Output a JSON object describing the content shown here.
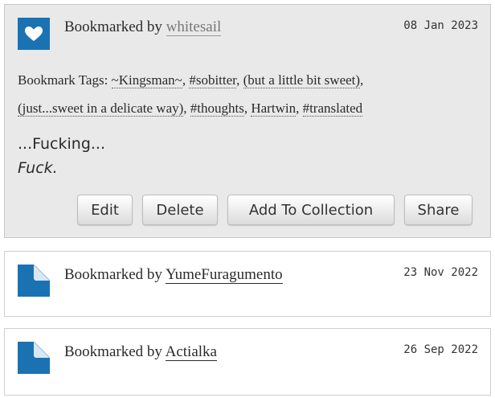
{
  "bookmarks": [
    {
      "by_label": "Bookmarked by",
      "user": "whitesail",
      "date": "08 Jan 2023",
      "tags_label": "Bookmark Tags:",
      "tags": [
        "~Kingsman~",
        "#sobitter",
        "(but a little bit sweet)",
        "(just...sweet in a delicate way)",
        "#thoughts",
        "Hartwin",
        "#translated"
      ],
      "note_lines": [
        "...Fucking...",
        "Fuck."
      ],
      "actions": {
        "edit": "Edit",
        "delete": "Delete",
        "add_to_collection": "Add To Collection",
        "share": "Share"
      },
      "icon": "heart-icon"
    },
    {
      "by_label": "Bookmarked by",
      "user": "YumeFuragumento",
      "date": "23 Nov 2022",
      "icon": "page-icon"
    },
    {
      "by_label": "Bookmarked by",
      "user": "Actialka",
      "date": "26 Sep 2022",
      "icon": "page-icon"
    }
  ],
  "colors": {
    "icon_blue": "#1a72b3",
    "own_card_bg": "#e9e9e9"
  }
}
